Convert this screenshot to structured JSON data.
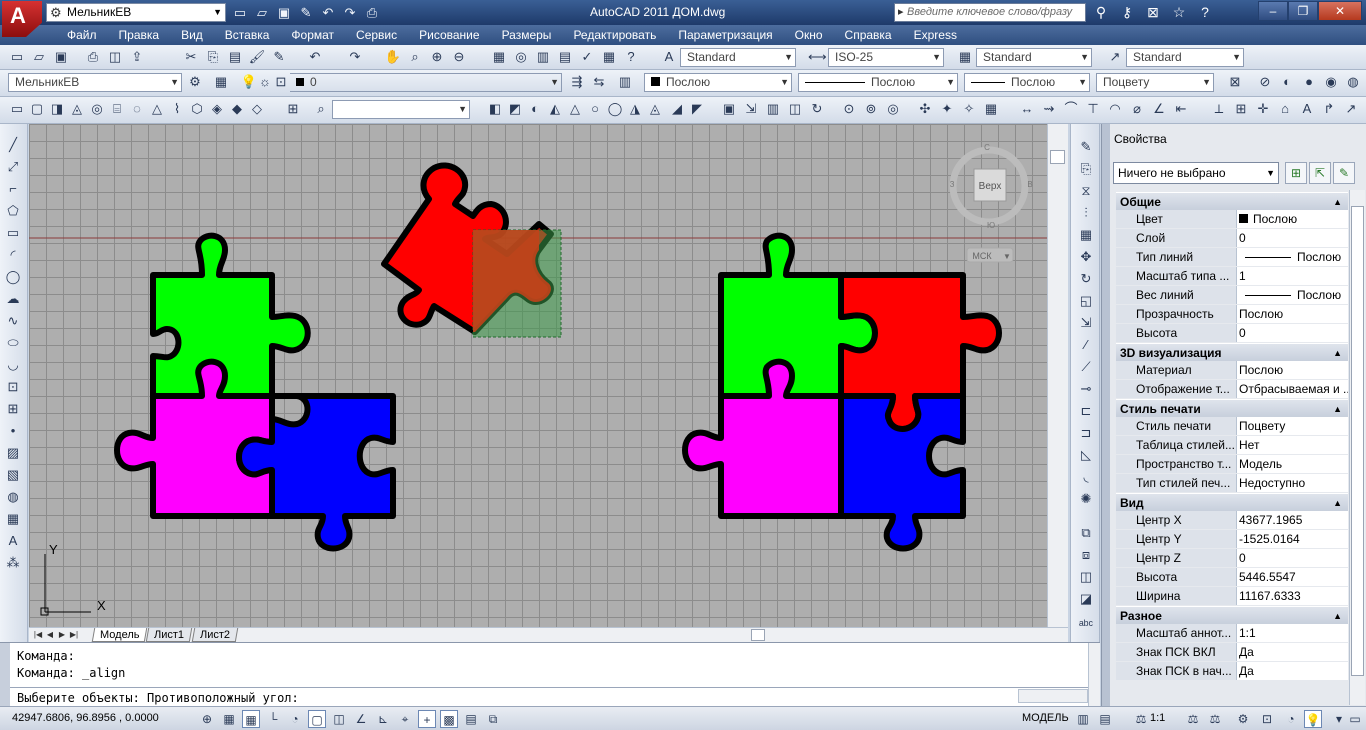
{
  "titlebar": {
    "workspace": "МельникЕВ",
    "title": "AutoCAD 2011    ДОМ.dwg",
    "search_placeholder": "Введите ключевое слово/фразу"
  },
  "menu": [
    "Файл",
    "Правка",
    "Вид",
    "Вставка",
    "Формат",
    "Сервис",
    "Рисование",
    "Размеры",
    "Редактировать",
    "Параметризация",
    "Окно",
    "Справка",
    "Express"
  ],
  "toolbar1": {
    "text_style": "Standard",
    "dim_style": "ISO-25",
    "table_style": "Standard",
    "mleader_style": "Standard"
  },
  "toolbar2": {
    "workspace": "МельникЕВ",
    "layer": "0",
    "color": "Послою",
    "linetype": "Послою",
    "lineweight": "Послою",
    "plotstyle": "Поцвету"
  },
  "viewcube": {
    "face": "Верх",
    "north": "С",
    "south": "Ю",
    "west": "З",
    "east": "В",
    "ucs": "МСК"
  },
  "layout_tabs": [
    "Модель",
    "Лист1",
    "Лист2"
  ],
  "ucs_labels": {
    "x": "X",
    "y": "Y"
  },
  "properties": {
    "title": "Свойства",
    "selection": "Ничего не выбрано",
    "sections": [
      {
        "name": "Общие",
        "rows": [
          {
            "key": "Цвет",
            "value": "Послою",
            "kind": "color"
          },
          {
            "key": "Слой",
            "value": "0"
          },
          {
            "key": "Тип линий",
            "value": "Послою",
            "kind": "line"
          },
          {
            "key": "Масштаб типа ...",
            "value": "1"
          },
          {
            "key": "Вес линий",
            "value": "Послою",
            "kind": "line"
          },
          {
            "key": "Прозрачность",
            "value": "Послою"
          },
          {
            "key": "Высота",
            "value": "0"
          }
        ]
      },
      {
        "name": "3D визуализация",
        "rows": [
          {
            "key": "Материал",
            "value": "Послою"
          },
          {
            "key": "Отображение т...",
            "value": "Отбрасываемая и ..."
          }
        ]
      },
      {
        "name": "Стиль печати",
        "rows": [
          {
            "key": "Стиль печати",
            "value": "Поцвету"
          },
          {
            "key": "Таблица стилей...",
            "value": "Нет"
          },
          {
            "key": "Пространство т...",
            "value": "Модель"
          },
          {
            "key": "Тип стилей печ...",
            "value": "Недоступно"
          }
        ]
      },
      {
        "name": "Вид",
        "rows": [
          {
            "key": "Центр X",
            "value": "43677.1965"
          },
          {
            "key": "Центр Y",
            "value": "-1525.0164"
          },
          {
            "key": "Центр Z",
            "value": "0"
          },
          {
            "key": "Высота",
            "value": "5446.5547"
          },
          {
            "key": "Ширина",
            "value": "11167.6333"
          }
        ]
      },
      {
        "name": "Разное",
        "rows": [
          {
            "key": "Масштаб аннот...",
            "value": "1:1"
          },
          {
            "key": "Знак ПСК ВКЛ",
            "value": "Да"
          },
          {
            "key": "Знак ПСК в нач...",
            "value": "Да"
          }
        ]
      }
    ]
  },
  "command": {
    "lines": [
      "Команда:",
      "Команда: _align",
      "Выберите объекты: Противоположный угол:"
    ]
  },
  "status": {
    "coords": "42947.6806, 96.8956 , 0.0000",
    "model": "МОДЕЛЬ",
    "scale": "1:1"
  },
  "colors": {
    "green": "#00ff00",
    "red": "#ff0000",
    "magenta": "#ff00ff",
    "blue": "#0000ff",
    "selection": "#3c9a48"
  }
}
